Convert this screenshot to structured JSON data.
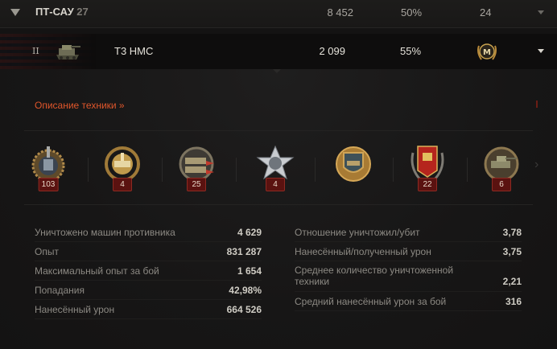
{
  "category": {
    "name": "ПТ-САУ",
    "count": "27",
    "battles": "8 452",
    "win_rate": "50%",
    "mastery_count": "24"
  },
  "vehicle": {
    "tier": "II",
    "name": "T3 HMC",
    "battles": "2 099",
    "win_rate": "55%",
    "mastery_badge": "M"
  },
  "details": {
    "description_link": "Описание техники »"
  },
  "medals": [
    {
      "icon": "tank-expert-medal-icon",
      "count": "103"
    },
    {
      "icon": "sniper-medal-icon",
      "count": "4"
    },
    {
      "icon": "tank-sniper-medal-icon",
      "count": "25"
    },
    {
      "icon": "invader-medal-icon",
      "count": "4"
    },
    {
      "icon": "defender-medal-icon",
      "count": ""
    },
    {
      "icon": "red-banner-medal-icon",
      "count": "22"
    },
    {
      "icon": "top-gun-medal-icon",
      "count": "6"
    }
  ],
  "stats_left": [
    {
      "label": "Уничтожено машин противника",
      "value": "4 629"
    },
    {
      "label": "Опыт",
      "value": "831 287"
    },
    {
      "label": "Максимальный опыт за бой",
      "value": "1 654"
    },
    {
      "label": "Попадания",
      "value": "42,98%"
    },
    {
      "label": "Нанесённый урон",
      "value": "664 526"
    }
  ],
  "stats_right": [
    {
      "label": "Отношение уничтожил/убит",
      "value": "3,78"
    },
    {
      "label": "Нанесённый/полученный урон",
      "value": "3,75"
    },
    {
      "label": "Среднее количество уничтоженной техники",
      "value": "2,21"
    },
    {
      "label": "Средний нанесённый урон за бой",
      "value": "316"
    }
  ],
  "colors": {
    "accent_link": "#e0562b",
    "medal_count_bg": "#5a1210"
  }
}
